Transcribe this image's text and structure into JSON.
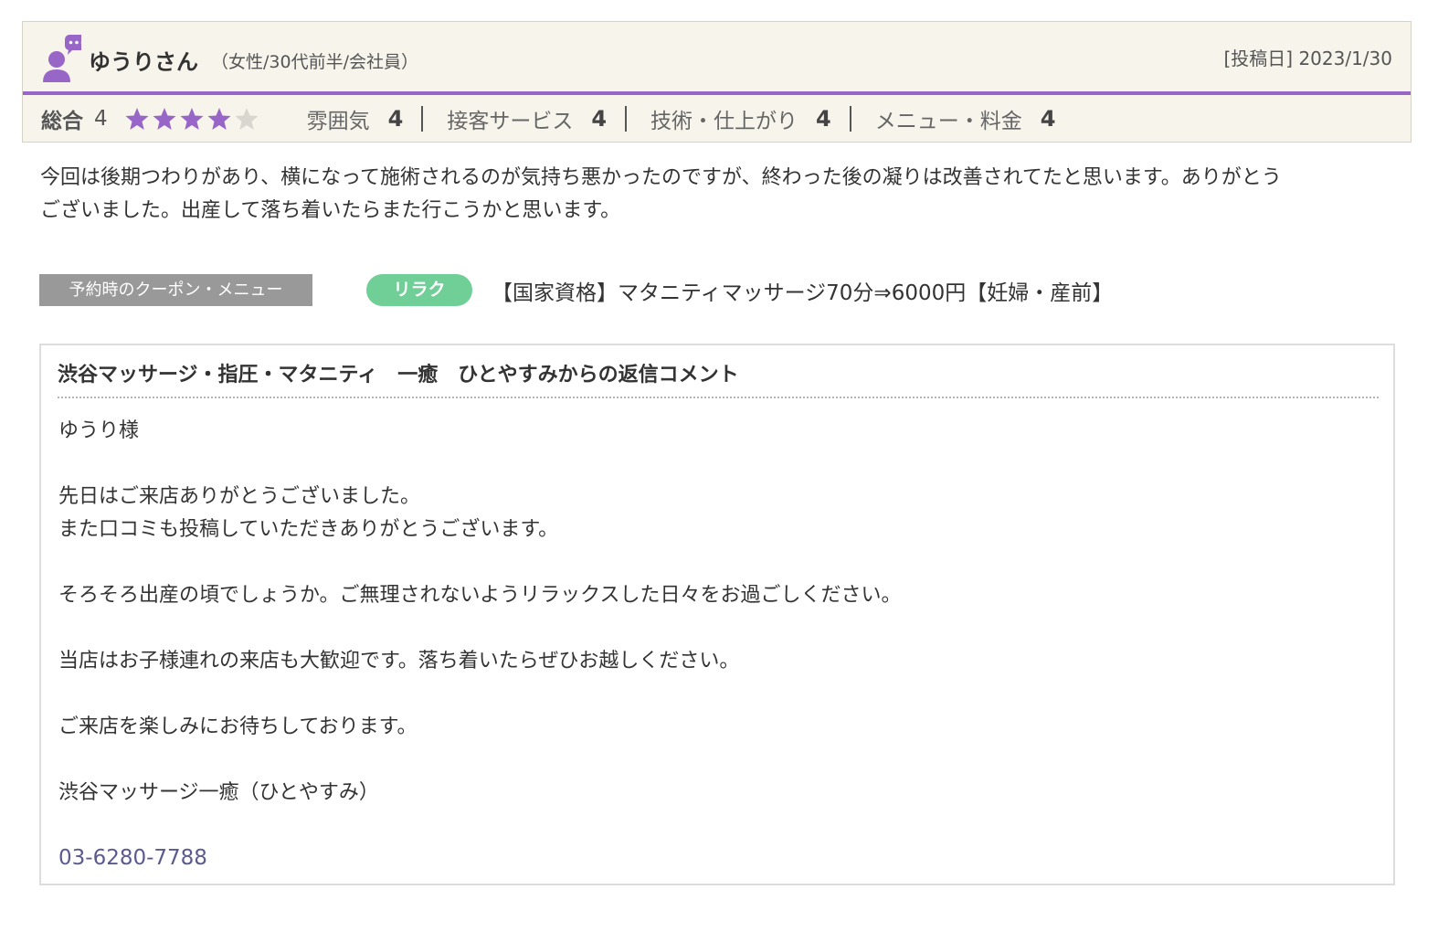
{
  "review": {
    "reviewer_name": "ゆうりさん",
    "reviewer_meta": "（女性/30代前半/会社員）",
    "post_date": "[投稿日] 2023/1/30",
    "accent_color": "#9866c7",
    "overall": {
      "label": "総合",
      "value": "4",
      "stars": 4,
      "max_stars": 5
    },
    "sub_ratings": [
      {
        "label": "雰囲気",
        "value": "4"
      },
      {
        "label": "接客サービス",
        "value": "4"
      },
      {
        "label": "技術・仕上がり",
        "value": "4"
      },
      {
        "label": "メニュー・料金",
        "value": "4"
      }
    ],
    "body_lines": [
      "今回は後期つわりがあり、横になって施術されるのが気持ち悪かったのですが、終わった後の凝りは改善されてたと思います。ありがとう",
      "ございました。出産して落ち着いたらまた行こうかと思います。"
    ],
    "icons": {
      "avatar": "user-comment-icon",
      "star_filled": "star-icon",
      "star_empty": "star-outline-icon"
    }
  },
  "coupon": {
    "label": "予約時のクーポン・メニュー",
    "badge": "リラク",
    "badge_color": "#6fcf97",
    "menu": "【国家資格】マタニティマッサージ70分⇒6000円【妊婦・産前】"
  },
  "reply": {
    "title": "渋谷マッサージ・指圧・マタニティ　一癒　ひとやすみからの返信コメント",
    "lines": [
      "ゆうり様",
      "",
      "先日はご来店ありがとうございました。",
      "また口コミも投稿していただきありがとうございます。",
      "",
      "そろそろ出産の頃でしょうか。ご無理されないようリラックスした日々をお過ごしください。",
      "",
      "当店はお子様連れの来店も大歓迎です。落ち着いたらぜひお越しください。",
      "",
      "ご来店を楽しみにお待ちしております。",
      "",
      "渋谷マッサージ一癒（ひとやすみ）"
    ],
    "phone": "03-6280-7788",
    "phone_color": "#5b5a8f"
  }
}
